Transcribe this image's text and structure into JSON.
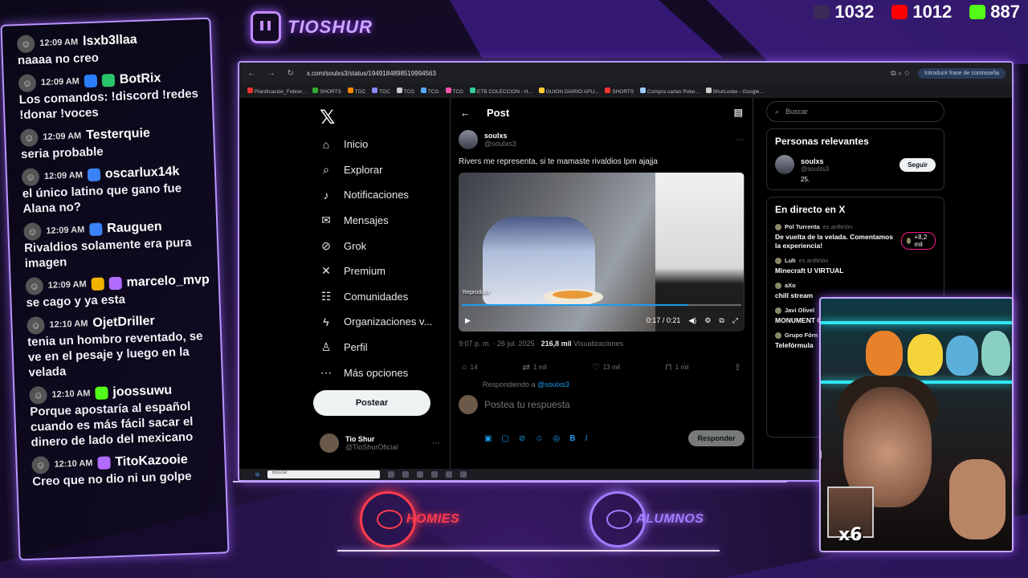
{
  "overlay": {
    "brand_name": "TIOSHUR",
    "stats": [
      {
        "icon": "twitch-icon",
        "value": "1032",
        "color": "#9146ff"
      },
      {
        "icon": "youtube-icon",
        "value": "1012",
        "color": "#ff0000"
      },
      {
        "icon": "kick-icon",
        "value": "887",
        "color": "#53fc18"
      }
    ],
    "teams": [
      {
        "name": "HOMIES",
        "color": "#ff3b4e"
      },
      {
        "name": "ALUMNOS",
        "color": "#a27bff"
      }
    ],
    "cam_counter": "x6",
    "cam_partial_text": "M"
  },
  "chat": [
    {
      "time": "12:09 AM",
      "user": "lsxb3llaa",
      "text": "naaaa no creo",
      "badges": []
    },
    {
      "time": "12:09 AM",
      "user": "BotRix",
      "text": "Los comandos: !discord !redes !donar !voces",
      "badges": [
        "#2a7fff",
        "#27c46a"
      ]
    },
    {
      "time": "12:09 AM",
      "user": "Testerquie",
      "text": "seria probable",
      "badges": []
    },
    {
      "time": "12:09 AM",
      "user": "oscarlux14k",
      "text": "el único latino que gano fue Alana no?",
      "badges": [
        "#3b82f6"
      ]
    },
    {
      "time": "12:09 AM",
      "user": "Rauguen",
      "text": "Rivaldios solamente era pura imagen",
      "badges": [
        "#3b82f6"
      ]
    },
    {
      "time": "12:09 AM",
      "user": "marcelo_mvp",
      "text": "se cago y ya esta",
      "badges": [
        "#f0b400",
        "#b06bff"
      ]
    },
    {
      "time": "12:10 AM",
      "user": "OjetDriller",
      "text": "tenia un hombro reventado, se ve en el pesaje y luego en la velada",
      "badges": []
    },
    {
      "time": "12:10 AM",
      "user": "joossuwu",
      "text": "Porque apostaría al español cuando es más fácil sacar el dinero de lado del mexicano",
      "badges": [
        "#53fc18"
      ]
    },
    {
      "time": "12:10 AM",
      "user": "TitoKazooie",
      "text": "Creo que no dio ni un golpe",
      "badges": [
        "#b06bff"
      ]
    }
  ],
  "browser": {
    "url": "x.com/soulxs3/status/1949184898519994563",
    "password_pill": "Introducir frase de contraseña",
    "bookmarks": [
      "Planificación_Febrer...",
      "SHORTS",
      "TGC",
      "TGC",
      "TCG",
      "TCG",
      "TCG",
      "ETB COLECCION - H...",
      "GUION DIARIO APU...",
      "SHORTS",
      "Compra cartas Poke...",
      "ShurLocke - Google..."
    ],
    "taskbar_search": "Buscar"
  },
  "x_nav": {
    "items": [
      {
        "label": "Inicio",
        "icon": "home-icon",
        "glyph": "⌂"
      },
      {
        "label": "Explorar",
        "icon": "search-icon",
        "glyph": "⌕"
      },
      {
        "label": "Notificaciones",
        "icon": "bell-icon",
        "glyph": "♪"
      },
      {
        "label": "Mensajes",
        "icon": "mail-icon",
        "glyph": "✉"
      },
      {
        "label": "Grok",
        "icon": "grok-icon",
        "glyph": "⊘"
      },
      {
        "label": "Premium",
        "icon": "x-premium-icon",
        "glyph": "✕"
      },
      {
        "label": "Comunidades",
        "icon": "communities-icon",
        "glyph": "☷"
      },
      {
        "label": "Organizaciones v...",
        "icon": "bolt-icon",
        "glyph": "ϟ"
      },
      {
        "label": "Perfil",
        "icon": "profile-icon",
        "glyph": "♙"
      },
      {
        "label": "Más opciones",
        "icon": "more-icon",
        "glyph": "⋯"
      }
    ],
    "post_button": "Postear",
    "profile_name": "Tio Shur",
    "profile_handle": "@TioShurOficial"
  },
  "post": {
    "header": "Post",
    "author_name": "soulxs",
    "author_handle": "@soulxs3",
    "text": "Rivers me representa, si te mamaste rivaldios lpm ajajja",
    "video_label": "Reproducir",
    "video_time": "0:17 / 0:21",
    "video_progress": 0.81,
    "meta_time": "9:07 p. m. · 26 jul. 2025 · ",
    "views_count": "216,8 mil",
    "views_label": " Visualizaciones",
    "replies": "14",
    "reposts": "1 mil",
    "likes": "13 mil",
    "bookmarks": "1 mil",
    "replying_prefix": "Respondiendo a ",
    "replying_to": "@soulxs3",
    "reply_placeholder": "Postea tu respuesta",
    "reply_button": "Responder"
  },
  "sidebar": {
    "search_placeholder": "Buscar",
    "relevant_title": "Personas relevantes",
    "relevant_name": "soulxs",
    "relevant_handle": "@soulxs3",
    "relevant_bio": "25.",
    "follow_label": "Seguir",
    "live_title": "En directo en X",
    "live": [
      {
        "host": "Pol Turrenta",
        "note": "es anfitrión",
        "title": "De vuelta de la velada. Comentamos la experiencia!",
        "listeners": "+8,2 mil"
      },
      {
        "host": "Luh",
        "note": "es anfitrión",
        "title": "Minecraft U VIRTUAL",
        "listeners": ""
      },
      {
        "host": "aXo",
        "note": "",
        "title": "chill stream",
        "listeners": ""
      },
      {
        "host": "Javi Olivel",
        "note": "",
        "title": "MONUMENT GLORIA CA",
        "listeners": ""
      },
      {
        "host": "Grupo Fórn",
        "note": "",
        "title": "Telefórmula",
        "listeners": ""
      }
    ]
  }
}
